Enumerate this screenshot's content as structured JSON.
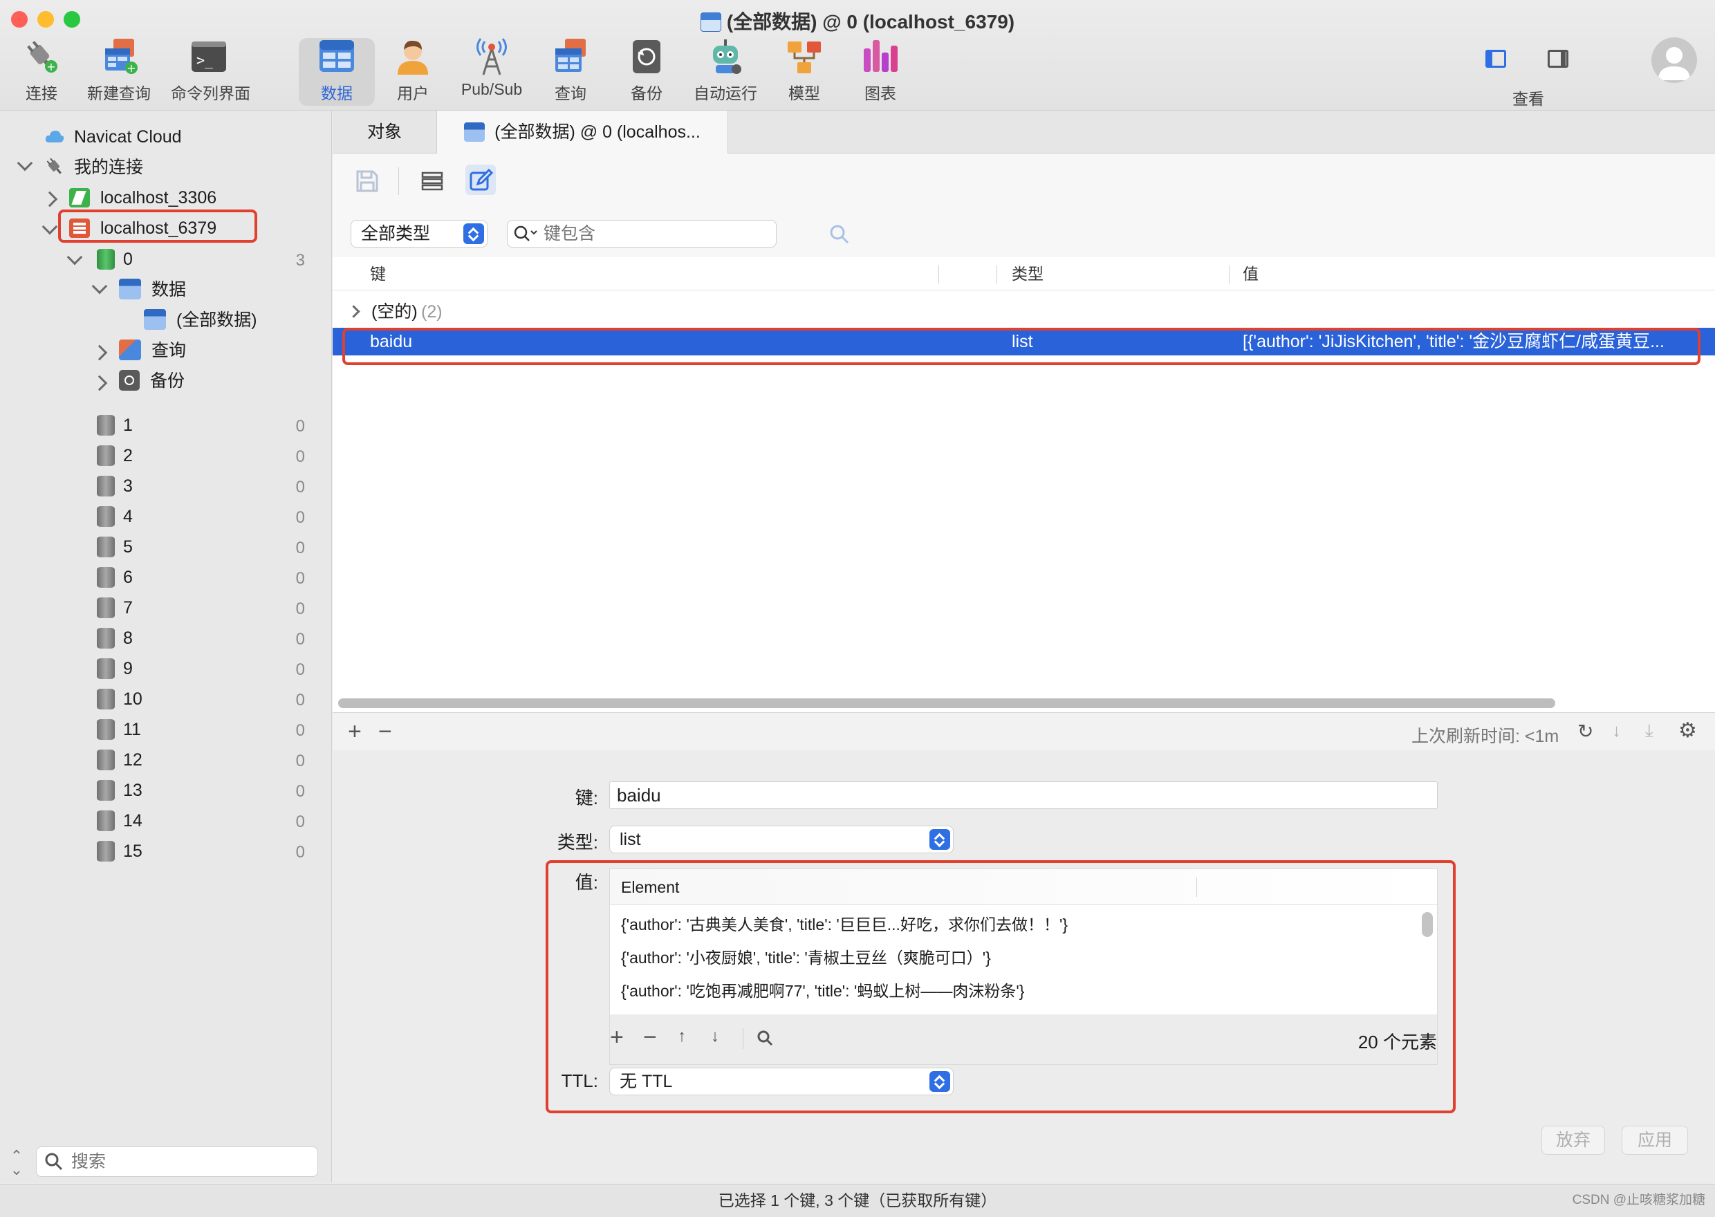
{
  "window": {
    "title": "(全部数据) @ 0 (localhost_6379)"
  },
  "toolbar": {
    "items": [
      {
        "label": "连接",
        "icon": "plug-icon"
      },
      {
        "label": "新建查询",
        "icon": "new-query-icon"
      },
      {
        "label": "命令列界面",
        "icon": "terminal-icon"
      },
      {
        "label": "数据",
        "icon": "table-icon",
        "selected": true
      },
      {
        "label": "用户",
        "icon": "user-icon"
      },
      {
        "label": "Pub/Sub",
        "icon": "antenna-icon"
      },
      {
        "label": "查询",
        "icon": "query-icon"
      },
      {
        "label": "备份",
        "icon": "backup-icon"
      },
      {
        "label": "自动运行",
        "icon": "robot-icon"
      },
      {
        "label": "模型",
        "icon": "model-icon"
      },
      {
        "label": "图表",
        "icon": "chart-icon"
      }
    ],
    "view_label": "查看"
  },
  "sidebar": {
    "cloud": "Navicat Cloud",
    "my_connections": "我的连接",
    "conn1": "localhost_3306",
    "conn2": "localhost_6379",
    "db0": {
      "name": "0",
      "count": "3"
    },
    "data_folder": "数据",
    "all_data": "(全部数据)",
    "query_folder": "查询",
    "backup_folder": "备份",
    "dbs": [
      {
        "name": "1",
        "count": "0"
      },
      {
        "name": "2",
        "count": "0"
      },
      {
        "name": "3",
        "count": "0"
      },
      {
        "name": "4",
        "count": "0"
      },
      {
        "name": "5",
        "count": "0"
      },
      {
        "name": "6",
        "count": "0"
      },
      {
        "name": "7",
        "count": "0"
      },
      {
        "name": "8",
        "count": "0"
      },
      {
        "name": "9",
        "count": "0"
      },
      {
        "name": "10",
        "count": "0"
      },
      {
        "name": "11",
        "count": "0"
      },
      {
        "name": "12",
        "count": "0"
      },
      {
        "name": "13",
        "count": "0"
      },
      {
        "name": "14",
        "count": "0"
      },
      {
        "name": "15",
        "count": "0"
      }
    ],
    "search_placeholder": "搜索"
  },
  "tabs": {
    "objects": "对象",
    "data": "(全部数据) @ 0 (localhos..."
  },
  "filter": {
    "type_select": "全部类型",
    "key_placeholder": "键包含"
  },
  "table": {
    "headers": {
      "key": "键",
      "type": "类型",
      "value": "值"
    },
    "group": {
      "label": "(空的)",
      "count": "(2)"
    },
    "selected_row": {
      "key": "baidu",
      "type": "list",
      "value": "[{'author': 'JiJisKitchen', 'title': '金沙豆腐虾仁/咸蛋黄豆..."
    }
  },
  "footer": {
    "refresh": "上次刷新时间: <1m"
  },
  "detail": {
    "key_label": "键:",
    "key_value": "baidu",
    "type_label": "类型:",
    "type_value": "list",
    "value_label": "值:",
    "element_header": "Element",
    "elements": [
      "{'author': '古典美人美食', 'title': '巨巨巨...好吃，求你们去做！！'}",
      "{'author': '小夜厨娘', 'title': '青椒土豆丝（爽脆可口）'}",
      "{'author': '吃饱再减肥啊77', 'title': '蚂蚁上树——肉沫粉条'}"
    ],
    "element_count": "20 个元素",
    "ttl_label": "TTL:",
    "ttl_value": "无 TTL",
    "discard": "放弃",
    "apply": "应用"
  },
  "status": "已选择 1 个键, 3 个键（已获取所有键）",
  "watermark": "CSDN @止咳糖浆加糖",
  "colors": {
    "accent": "#2f6fe3",
    "selection": "#2962d9",
    "highlight_box": "#e0402f"
  }
}
